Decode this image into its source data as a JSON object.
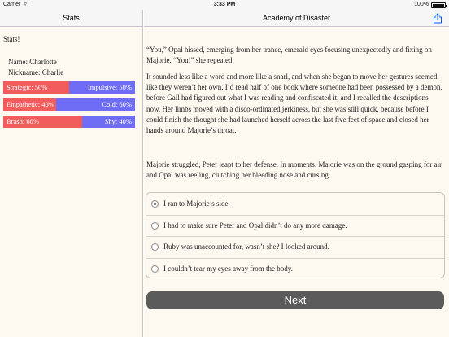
{
  "status_bar": {
    "carrier": "Carrier",
    "time": "3:33 PM",
    "battery": "100%"
  },
  "sidebar": {
    "title": "Stats",
    "heading": "Stats!",
    "name_line": "Name: Charlotte",
    "nickname_line": "Nickname: Charlie",
    "stats": [
      {
        "left_label": "Strategic: 50%",
        "right_label": "Impulsive: 50%",
        "left_value": 50
      },
      {
        "left_label": "Empathetic: 40%",
        "right_label": "Cold: 60%",
        "left_value": 40
      },
      {
        "left_label": "Brash: 60%",
        "right_label": "Shy: 40%",
        "left_value": 60
      }
    ],
    "colors": {
      "left": "#f25c5c",
      "right": "#6f6cf5"
    }
  },
  "main": {
    "title": "Academy of Disaster",
    "paragraphs": [
      "“You,” Opal hissed, emerging from her trance, emerald eyes focusing unexpectedly and fixing on Majorie. “You!” she repeated.",
      "It sounded less like a word and more like a snarl, and when she began to move her gestures seemed like they weren’t her own. I’d read half of one book where someone had been possessed by a demon, before Gail had figured out what I was reading and confiscated it, and I recalled the descriptions now. Her limbs moved with a disco-ordinated jerkiness, but she was still quick, because before I could finish the thought she had launched herself across the last five feet of space and closed her hands around Majorie’s throat.",
      "Majorie struggled, Peter leapt to her defense. In moments, Majorie was on the ground gasping for air and Opal was reeling, clutching her bleeding nose and cursing."
    ],
    "choices": [
      {
        "label": "I ran to Majorie’s side.",
        "selected": true
      },
      {
        "label": "I had to make sure Peter and Opal didn’t do any more damage.",
        "selected": false
      },
      {
        "label": "Ruby was unaccounted for, wasn’t she? I looked around.",
        "selected": false
      },
      {
        "label": "I couldn’t tear my eyes away from the body.",
        "selected": false
      }
    ],
    "next_label": "Next"
  }
}
